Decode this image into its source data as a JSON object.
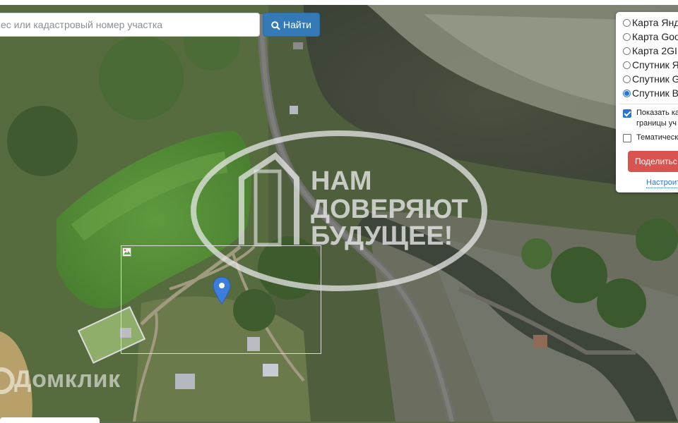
{
  "search": {
    "placeholder": "ес или кадастровый номер участка",
    "button_label": "Найти"
  },
  "layers": [
    {
      "label": "Карта Янд",
      "selected": false
    },
    {
      "label": "Карта Goo",
      "selected": false
    },
    {
      "label": "Карта 2GI",
      "selected": false
    },
    {
      "label": "Спутник Я",
      "selected": false
    },
    {
      "label": "Спутник G",
      "selected": false
    },
    {
      "label": "Спутник B",
      "selected": true
    }
  ],
  "options": {
    "show_boundaries_line1": "Показать ка",
    "show_boundaries_line2": "границы уч",
    "show_boundaries_checked": true,
    "thematic": "Тематическ",
    "thematic_checked": false
  },
  "share_button": "Поделитьс",
  "settings_link": "Настроит",
  "watermark": {
    "line1": "НАМ",
    "line2": "ДОВЕРЯЮТ",
    "line3": "БУДУЩЕЕ!"
  },
  "brand": "Домклик",
  "colors": {
    "button_blue": "#337ab7",
    "share_red": "#d9534f",
    "link_blue": "#2a74d8",
    "marker_blue": "#3b7ddd"
  }
}
